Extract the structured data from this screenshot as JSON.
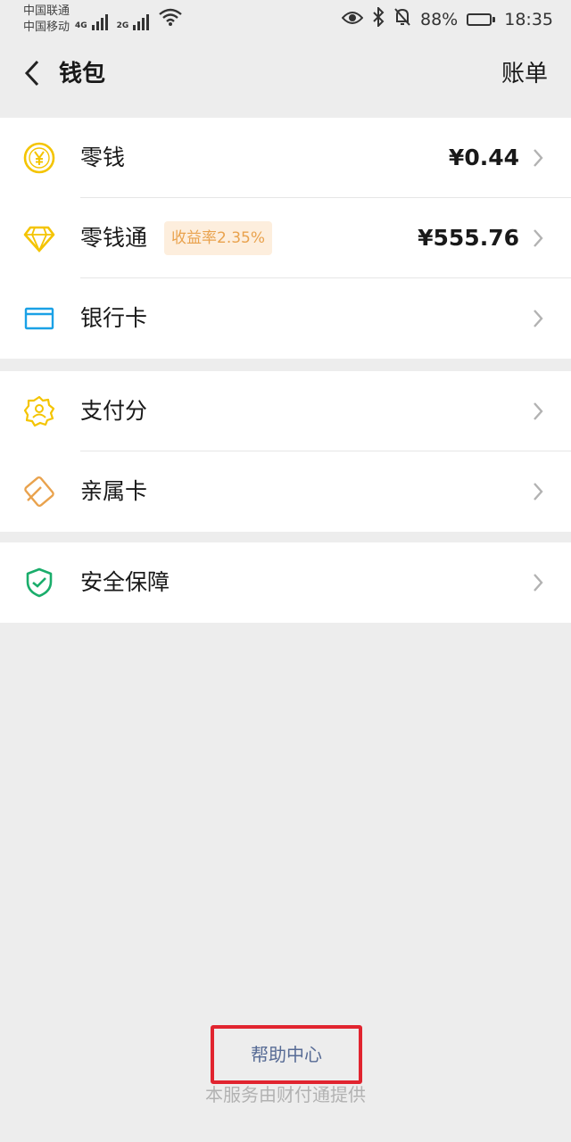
{
  "statusbar": {
    "carrier1": "中国联通",
    "carrier2": "中国移动",
    "net1": "4G",
    "net2": "2G",
    "battery_pct": "88%",
    "time": "18:35",
    "icons": [
      "eye-icon",
      "bluetooth-icon",
      "mute-bell-icon",
      "battery-icon"
    ]
  },
  "navbar": {
    "title": "钱包",
    "bill_label": "账单"
  },
  "sections": {
    "balance": {
      "label": "零钱",
      "amount": "¥0.44",
      "icon": "coin-yen-icon",
      "color": "#f4c400"
    },
    "savings": {
      "label": "零钱通",
      "badge": "收益率2.35%",
      "amount": "¥555.76",
      "icon": "diamond-icon",
      "color": "#f4c400"
    },
    "bankcard": {
      "label": "银行卡",
      "icon": "card-icon",
      "color": "#1aa1e6"
    },
    "payscore": {
      "label": "支付分",
      "icon": "badge-user-icon",
      "color": "#f4c400"
    },
    "familycard": {
      "label": "亲属卡",
      "icon": "family-card-icon",
      "color": "#e9a24d"
    },
    "security": {
      "label": "安全保障",
      "icon": "shield-check-icon",
      "color": "#1aad6b"
    }
  },
  "footer": {
    "help_label": "帮助中心",
    "provider_text": "本服务由财付通提供",
    "highlight_color": "#e1242f"
  }
}
